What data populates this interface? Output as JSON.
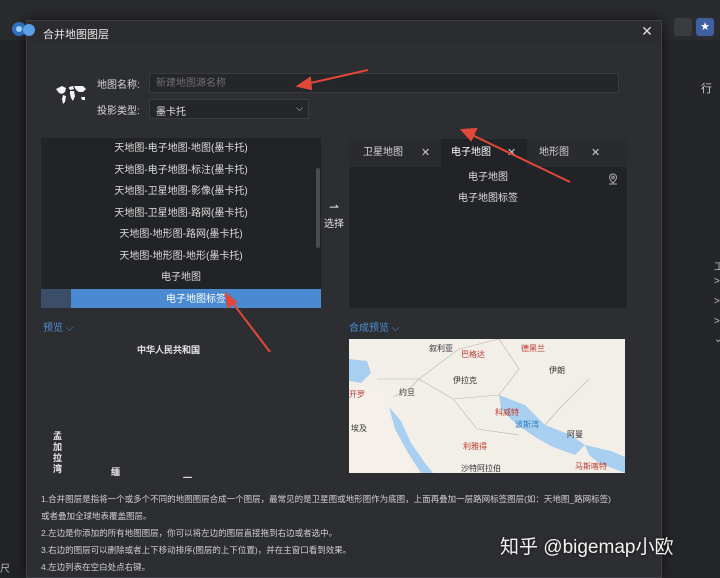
{
  "dialog": {
    "title": "合并地图图层",
    "map_name_label": "地图名称:",
    "map_name_placeholder": "新建地图源名称",
    "projection_label": "投影类型:",
    "projection_value": "墨卡托"
  },
  "left_list": {
    "items": [
      "天地图-电子地图-地图(墨卡托)",
      "天地图-电子地图-标注(墨卡托)",
      "天地图-卫星地图-影像(墨卡托)",
      "天地图-卫星地图-路网(墨卡托)",
      "天地图-地形图-路网(墨卡托)",
      "天地图-地形图-地形(墨卡托)",
      "电子地图",
      "电子地图标签"
    ],
    "selected_index": 7
  },
  "move_button": {
    "arrow": "⇀",
    "label": "选择"
  },
  "tabs": [
    {
      "label": "卫星地图",
      "close": "✕"
    },
    {
      "label": "电子地图",
      "close": "✕"
    },
    {
      "label": "地形图",
      "close": "✕"
    }
  ],
  "right_list": {
    "items": [
      "电子地图",
      "电子地图标签"
    ]
  },
  "preview": {
    "left_label": "预览 ⌵",
    "right_label": "合成预览 ⌵",
    "left_texts": [
      "中华人民共和国"
    ],
    "map_labels": [
      {
        "text": "叙利亚",
        "cls": ""
      },
      {
        "text": "巴格达",
        "cls": "red"
      },
      {
        "text": "德黑兰",
        "cls": "red"
      },
      {
        "text": "伊拉克",
        "cls": ""
      },
      {
        "text": "伊朗",
        "cls": ""
      },
      {
        "text": "约旦",
        "cls": ""
      },
      {
        "text": "开罗",
        "cls": "red"
      },
      {
        "text": "埃及",
        "cls": ""
      },
      {
        "text": "科威特",
        "cls": "red"
      },
      {
        "text": "波斯湾",
        "cls": "blue"
      },
      {
        "text": "阿曼",
        "cls": ""
      },
      {
        "text": "利雅得",
        "cls": "red"
      },
      {
        "text": "马斯喀特",
        "cls": "red"
      },
      {
        "text": "沙特阿拉伯",
        "cls": ""
      }
    ]
  },
  "notes": [
    "1.合并图层是指将一个或多个不同的地图图层合成一个图层，最常见的是卫星图或地形图作为底图，上面再叠加一层路网标签图层(如：天地图_路网标签)",
    "或者叠加全球地表覆盖图层。",
    "2.左边是你添加的所有地图图层，你可以将左边的图层直接拖到右边或者选中。",
    "3.右边的图层可以删除或者上下移动排序(图层的上下位置)，并在主窗口看到效果。",
    "4.左边列表在空白处点右键。"
  ],
  "watermark": "知乎 @bigemap小欧",
  "colors": {
    "accent": "#4a8ad0",
    "link": "#4b8fd6",
    "annotation_arrow": "#e0483a"
  }
}
